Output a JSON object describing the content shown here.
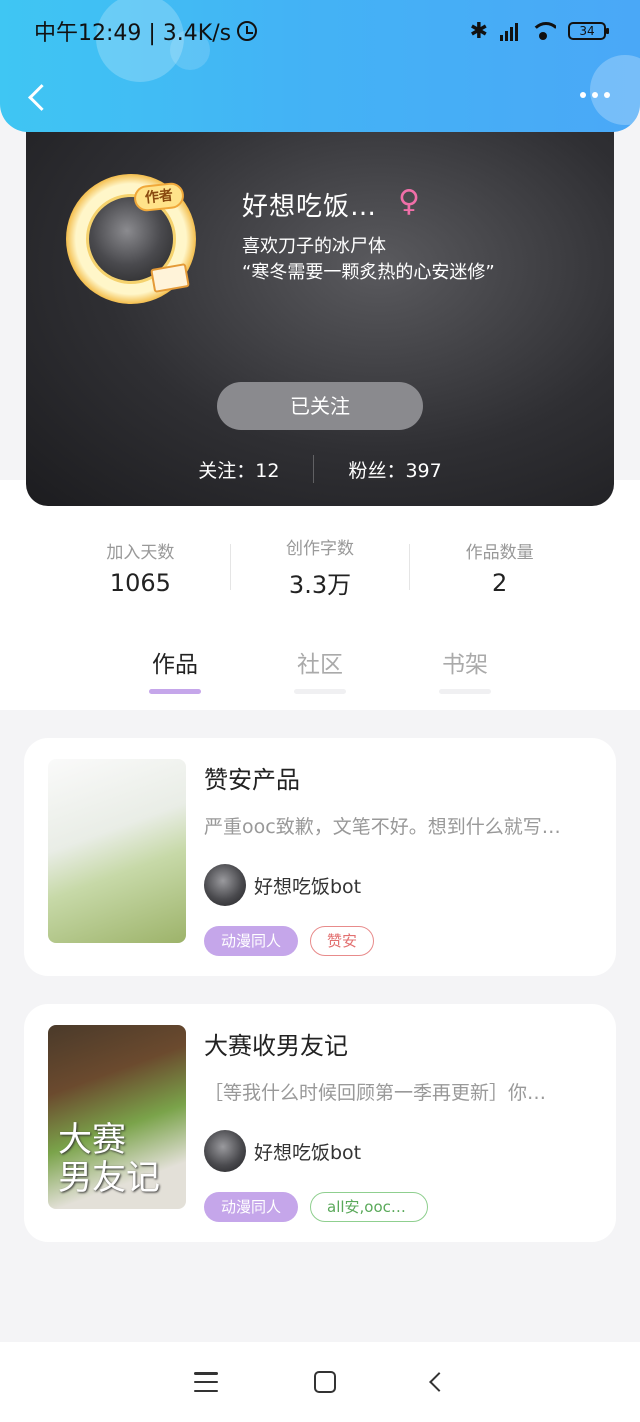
{
  "status_bar": {
    "time_speed": "中午12:49 | 3.4K/s",
    "battery": "34"
  },
  "profile": {
    "author_badge": "作者",
    "name": "好想吃饭…",
    "gender_symbol": "♀",
    "bio_line1": "喜欢刀子的冰尸体",
    "bio_line2": "“寒冬需要一颗炙热的心安迷修”",
    "follow_button": "已关注",
    "following": "关注：12",
    "fans": "粉丝：397"
  },
  "stats": [
    {
      "label": "加入天数",
      "value": "1065"
    },
    {
      "label": "创作字数",
      "value": "3.3万"
    },
    {
      "label": "作品数量",
      "value": "2"
    }
  ],
  "tabs": [
    {
      "label": "作品",
      "active": true
    },
    {
      "label": "社区",
      "active": false
    },
    {
      "label": "书架",
      "active": false
    }
  ],
  "works": [
    {
      "title": "赞安产品",
      "description": "严重ooc致歉，文笔不好。想到什么就写…",
      "author": "好想吃饭bot",
      "tags": [
        "动漫同人",
        "赞安"
      ]
    },
    {
      "title": "大赛收男友记",
      "description": "［等我什么时候回顾第一季再更新］你…",
      "author": "好想吃饭bot",
      "tags": [
        "动漫同人",
        "all安,ooc…"
      ],
      "cover_text": "大赛\n男友记"
    }
  ]
}
